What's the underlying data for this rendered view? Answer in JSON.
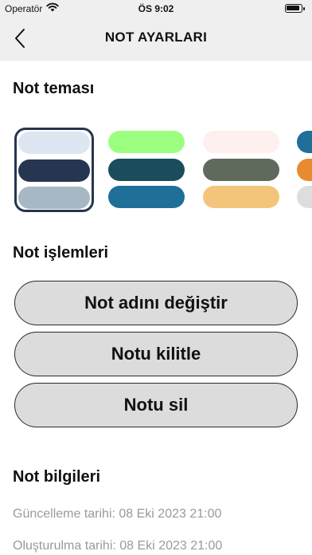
{
  "status_bar": {
    "carrier": "Operatör",
    "time": "ÖS 9:02"
  },
  "header": {
    "title": "NOT AYARLARI",
    "back_icon": "chevron-left-icon"
  },
  "theme_section": {
    "title": "Not teması",
    "themes": [
      {
        "selected": true,
        "colors": [
          "#dde6f1",
          "#263650",
          "#a7b8c4"
        ]
      },
      {
        "selected": false,
        "colors": [
          "#9cff80",
          "#1c4d5c",
          "#1f6f99"
        ]
      },
      {
        "selected": false,
        "colors": [
          "#fdf0ee",
          "#5f6a5c",
          "#f3c57a"
        ]
      },
      {
        "selected": false,
        "colors": [
          "#1f6f99",
          "#e88a2e",
          "#dddddd"
        ]
      }
    ]
  },
  "actions_section": {
    "title": "Not işlemleri",
    "rename_label": "Not adını değiştir",
    "lock_label": "Notu kilitle",
    "delete_label": "Notu sil"
  },
  "info_section": {
    "title": "Not bilgileri",
    "updated": "Güncelleme tarihi: 08 Eki 2023 21:00",
    "created": "Oluşturulma tarihi: 08 Eki 2023 21:00"
  }
}
